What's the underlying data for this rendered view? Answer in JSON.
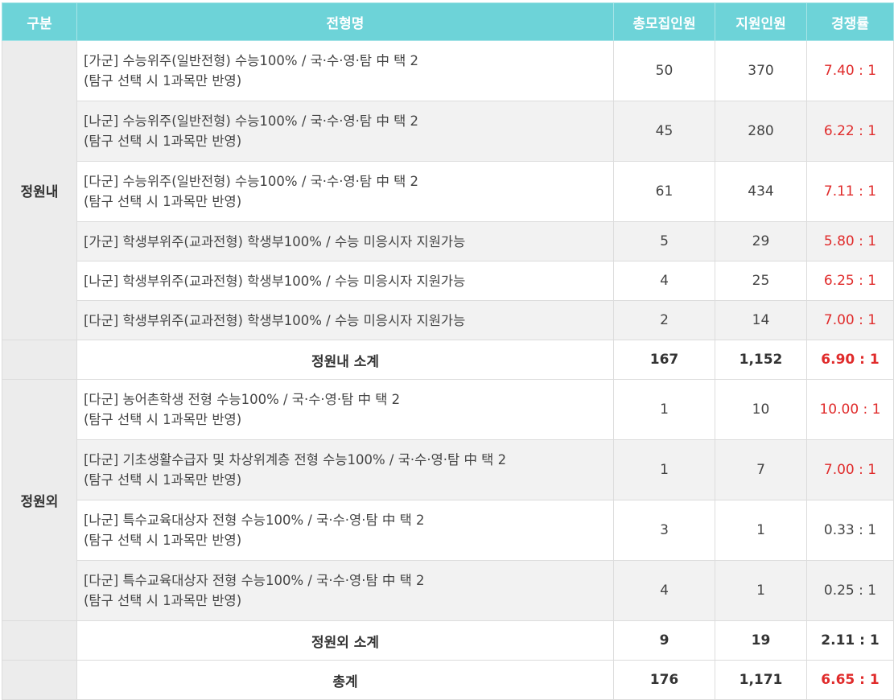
{
  "headers": [
    "구분",
    "전형명",
    "총모집인원",
    "지원인원",
    "경쟁률"
  ],
  "groups": {
    "in_label": "정원내",
    "out_label": "정원외"
  },
  "rows": [
    {
      "line1": "[가군] 수능위주(일반전형) 수능100% / 국·수·영·탐 中 택 2",
      "line2": "(탐구 선택 시 1과목만 반영)",
      "total": "50",
      "applicants": "370",
      "ratio": "7.40 : 1"
    },
    {
      "line1": "[나군] 수능위주(일반전형) 수능100% / 국·수·영·탐 中 택 2",
      "line2": "(탐구 선택 시 1과목만 반영)",
      "total": "45",
      "applicants": "280",
      "ratio": "6.22 : 1"
    },
    {
      "line1": "[다군] 수능위주(일반전형) 수능100% / 국·수·영·탐 中 택 2",
      "line2": "(탐구 선택 시 1과목만 반영)",
      "total": "61",
      "applicants": "434",
      "ratio": "7.11 : 1"
    },
    {
      "line1": "[가군] 학생부위주(교과전형) 학생부100% / 수능 미응시자 지원가능",
      "line2": "",
      "total": "5",
      "applicants": "29",
      "ratio": "5.80 : 1"
    },
    {
      "line1": "[나군] 학생부위주(교과전형) 학생부100% / 수능 미응시자 지원가능",
      "line2": "",
      "total": "4",
      "applicants": "25",
      "ratio": "6.25 : 1"
    },
    {
      "line1": "[다군] 학생부위주(교과전형) 학생부100% / 수능 미응시자 지원가능",
      "line2": "",
      "total": "2",
      "applicants": "14",
      "ratio": "7.00 : 1"
    },
    {
      "line1": "[다군] 농어촌학생 전형 수능100% / 국·수·영·탐 中 택 2",
      "line2": "(탐구 선택 시 1과목만 반영)",
      "total": "1",
      "applicants": "10",
      "ratio": "10.00 : 1"
    },
    {
      "line1": "[다군] 기초생활수급자 및 차상위계층 전형 수능100% / 국·수·영·탐 中 택 2",
      "line2": "(탐구 선택 시 1과목만 반영)",
      "total": "1",
      "applicants": "7",
      "ratio": "7.00 : 1"
    },
    {
      "line1": "[나군] 특수교육대상자 전형 수능100% / 국·수·영·탐 中 택 2",
      "line2": "(탐구 선택 시 1과목만 반영)",
      "total": "3",
      "applicants": "1",
      "ratio": "0.33 : 1"
    },
    {
      "line1": "[다군] 특수교육대상자 전형 수능100% / 국·수·영·탐 中 택 2",
      "line2": "(탐구 선택 시 1과목만 반영)",
      "total": "4",
      "applicants": "1",
      "ratio": "0.25 : 1"
    }
  ],
  "subtotal_in": {
    "label": "정원내 소계",
    "total": "167",
    "applicants": "1,152",
    "ratio": "6.90 : 1"
  },
  "subtotal_out": {
    "label": "정원외 소계",
    "total": "9",
    "applicants": "19",
    "ratio": "2.11 : 1"
  },
  "grand_total": {
    "label": "총계",
    "total": "176",
    "applicants": "1,171",
    "ratio": "6.65 : 1"
  },
  "colors": {
    "header_bg": "#6dd3d8",
    "ratio_red": "#e02b2b",
    "category_bg": "#ececec"
  }
}
